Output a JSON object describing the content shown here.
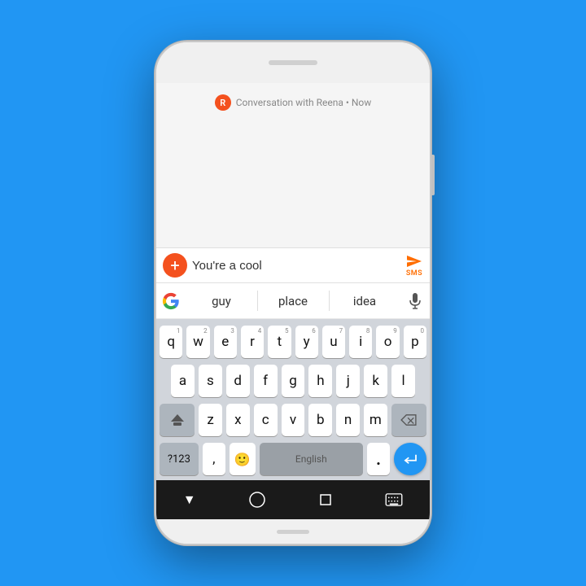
{
  "background": "#2196F3",
  "phone": {
    "conversation_label": "Conversation with Reena • Now",
    "avatar_initial": "R",
    "input_text": "You're a cool ",
    "input_placeholder": "",
    "send_label": "SMS",
    "suggestions": [
      "guy",
      "place",
      "idea"
    ],
    "keyboard": {
      "row1": [
        {
          "char": "q",
          "num": "1"
        },
        {
          "char": "w",
          "num": "2"
        },
        {
          "char": "e",
          "num": "3"
        },
        {
          "char": "r",
          "num": "4"
        },
        {
          "char": "t",
          "num": "5"
        },
        {
          "char": "y",
          "num": "6"
        },
        {
          "char": "u",
          "num": "7"
        },
        {
          "char": "i",
          "num": "8"
        },
        {
          "char": "o",
          "num": "9"
        },
        {
          "char": "p",
          "num": "0"
        }
      ],
      "row2": [
        "a",
        "s",
        "d",
        "f",
        "g",
        "h",
        "j",
        "k",
        "l"
      ],
      "row3": [
        "z",
        "x",
        "c",
        "v",
        "b",
        "n",
        "m"
      ],
      "space_label": "English",
      "num_label": "?123",
      "comma": ",",
      "period": "."
    },
    "nav": {
      "back": "▼",
      "home": "○",
      "recents": "□",
      "keyboard": "⌨"
    }
  }
}
